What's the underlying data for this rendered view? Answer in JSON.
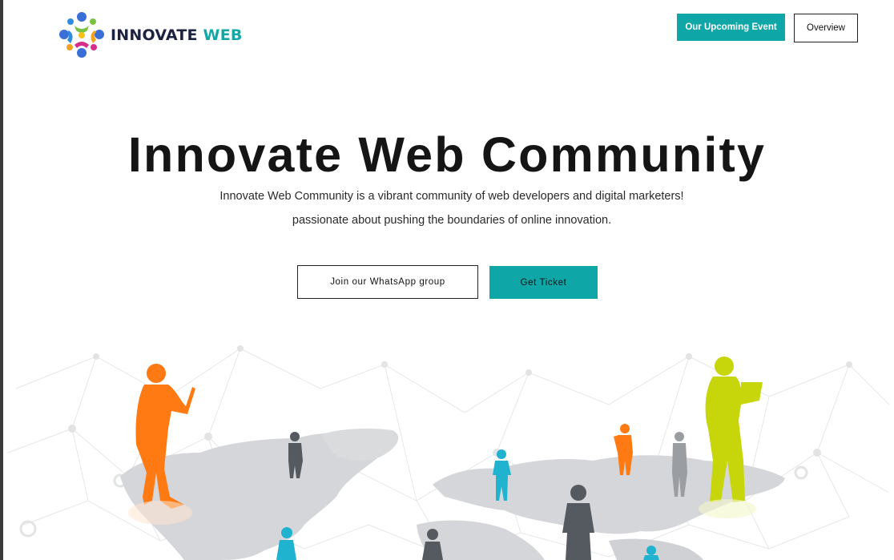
{
  "brand": {
    "name_part1": "INNOVATE",
    "name_part2": "WEB",
    "dark_color": "#1c2340",
    "accent_color": "#13a8a6",
    "logo_icon": "people-circle-logo"
  },
  "header": {
    "event_button_label": "Our Upcoming Event",
    "overview_button_label": "Overview"
  },
  "hero": {
    "title": "Innovate Web Community",
    "description_line1": "Innovate Web Community is a vibrant community of web developers and digital marketers!",
    "description_line2": "passionate about pushing the boundaries of online innovation.",
    "whatsapp_button_label": "Join our WhatsApp group",
    "ticket_button_label": "Get Ticket"
  },
  "illustration": {
    "subject": "world-map-with-people-silhouettes",
    "colors": {
      "teal": "#0fa6a8",
      "orange": "#ff7a12",
      "lime": "#c7d60a",
      "cyan": "#1fb3cf",
      "gray": "#555a60",
      "map": "#d4d6d9"
    }
  }
}
